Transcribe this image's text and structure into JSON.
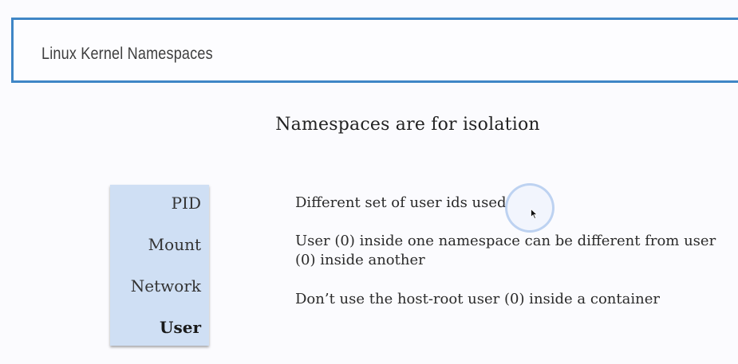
{
  "header": {
    "title": "Linux Kernel Namespaces"
  },
  "main": {
    "heading": "Namespaces are for isolation",
    "namespaces": [
      {
        "label": "PID",
        "active": false
      },
      {
        "label": "Mount",
        "active": false
      },
      {
        "label": "Network",
        "active": false
      },
      {
        "label": "User",
        "active": true
      }
    ],
    "descriptions": [
      "Different set of user ids used",
      "User (0) inside one namespace can be different from user (0) inside another",
      "Don’t use the host-root user (0) inside a container"
    ]
  },
  "colors": {
    "accent_border": "#3f86c6",
    "panel_background": "#cfdff4",
    "page_background": "#fbfbfe"
  },
  "icons": {
    "cursor": "mouse-pointer-icon",
    "click_indicator": "click-ring-icon"
  }
}
